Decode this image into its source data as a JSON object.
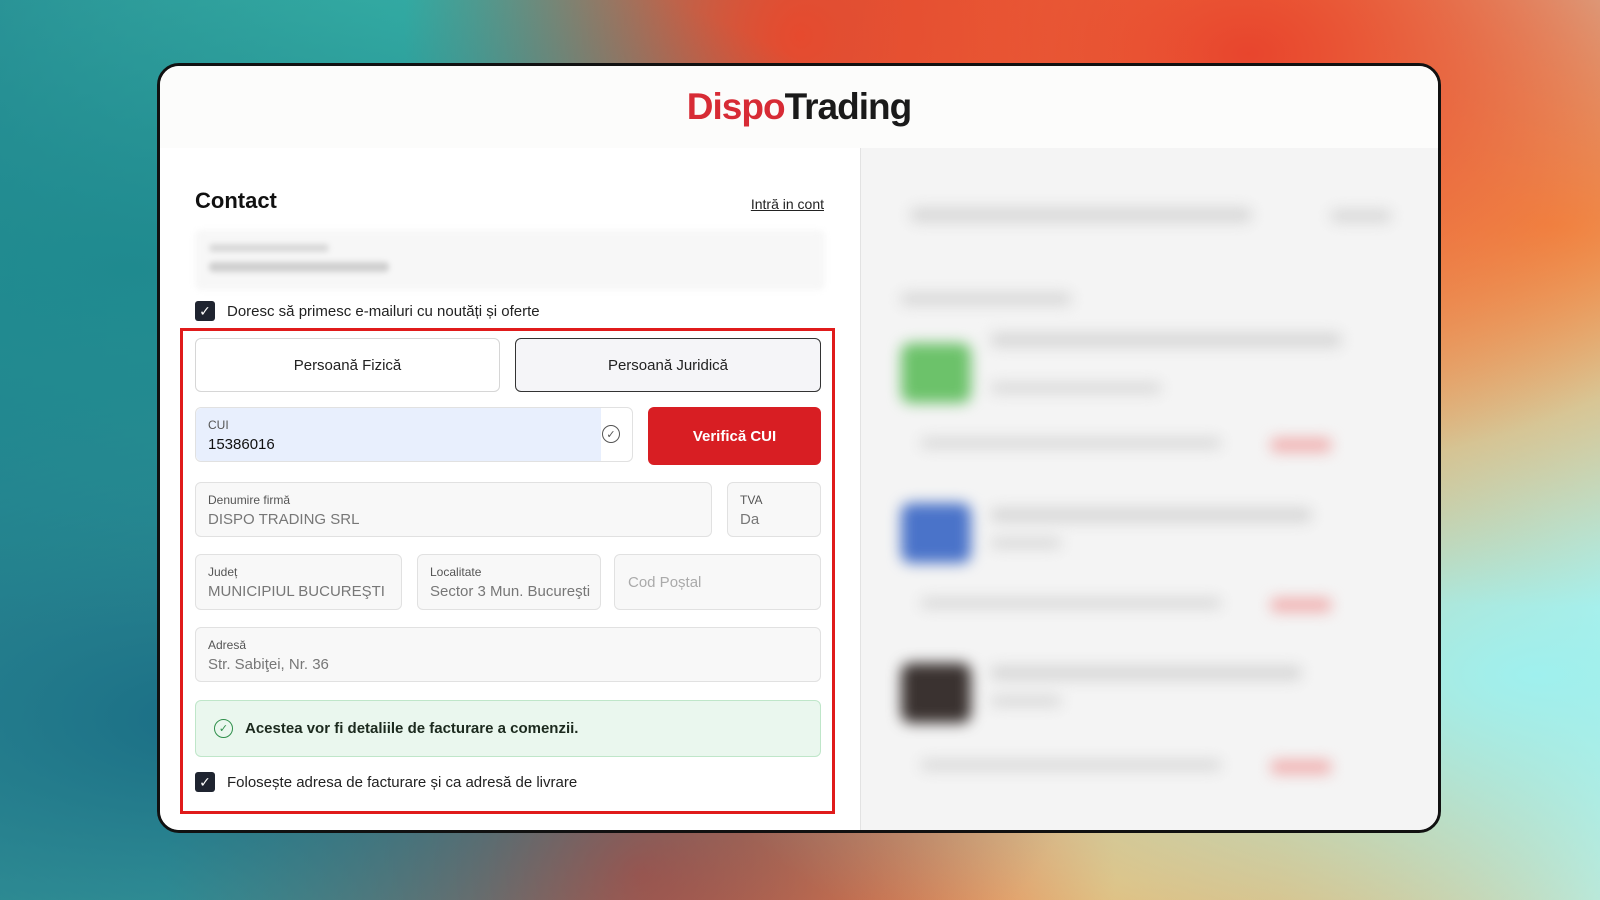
{
  "brand": {
    "part1": "Dispo",
    "part2": "Trading",
    "red": "#d72b35",
    "dark": "#1a1a1a"
  },
  "contact": {
    "title": "Contact",
    "login_link": "Intră in cont",
    "newsletter_label": "Doresc să primesc e-mailuri cu noutăți și oferte",
    "newsletter_checked": true
  },
  "person_type": {
    "options": [
      "Persoană Fizică",
      "Persoană Juridică"
    ],
    "selected": "Persoană Juridică"
  },
  "company": {
    "cui_label": "CUI",
    "cui_value": "15386016",
    "verify_button": "Verifică CUI",
    "name_label": "Denumire firmă",
    "name_value": "DISPO TRADING SRL",
    "tva_label": "TVA",
    "tva_value": "Da",
    "county_label": "Județ",
    "county_value": "MUNICIPIUL BUCUREŞTI",
    "locality_label": "Localitate",
    "locality_value": "Sector 3 Mun. Bucureşti",
    "postal_placeholder": "Cod Poștal",
    "address_label": "Adresă",
    "address_value": "Str. Sabiţei, Nr. 36"
  },
  "billing_notice": "Acestea vor fi detaliile de facturare a comenzii.",
  "same_address": {
    "label": "Folosește adresa de facturare și ca adresă de livrare",
    "checked": true
  },
  "colors": {
    "accent_red": "#d81e23",
    "highlight_red": "#e01b1b",
    "success_green": "#2f8f4b"
  }
}
